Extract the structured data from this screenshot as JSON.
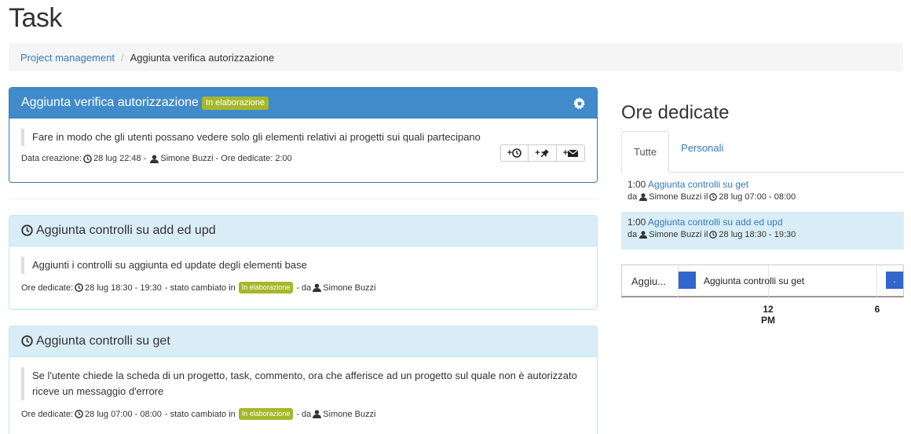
{
  "page": {
    "title": "Task"
  },
  "breadcrumb": {
    "link": "Project management",
    "current": "Aggiunta verifica autorizzazione"
  },
  "task": {
    "title": "Aggiunta verifica autorizzazione",
    "status": "In elaborazione",
    "description": "Fare in modo che gli utenti possano vedere solo gli elementi relativi ai progetti sui quali partecipano",
    "created_label": "Data creazione:",
    "created_date": "28 lug 22:48",
    "author": "Simone Buzzi",
    "hours_label": "- Ore dedicate: 2:00",
    "buttons": {
      "add_time": "+",
      "add_pin": "+",
      "add_mail": "+"
    }
  },
  "activities": [
    {
      "title": "Aggiunta controlli su add ed upd",
      "description": "Aggiunti i controlli su aggiunta ed update degli elementi base",
      "hours_label": "Ore dedicate:",
      "time": "28 lug 18:30 - 19:30",
      "status_label": "- stato cambiato in",
      "status": "In elaborazione",
      "by": "- da",
      "author": "Simone Buzzi"
    },
    {
      "title": "Aggiunta controlli su get",
      "description": "Se l'utente chiede la scheda di un progetto, task, commento, ora che afferisce ad un progetto sul quale non è autorizzato riceve un messaggio d'errore",
      "hours_label": "Ore dedicate:",
      "time": "28 lug 07:00 - 08:00",
      "status_label": "- stato cambiato in",
      "status": "In elaborazione",
      "by": "- da",
      "author": "Simone Buzzi"
    }
  ],
  "sidebar": {
    "title": "Ore dedicate",
    "tabs": [
      "Tutte",
      "Personali"
    ],
    "entries": [
      {
        "hours": "1:00",
        "title": "Aggiunta controlli su get",
        "by": "da",
        "author": "Simone Buzzi",
        "at": "il",
        "time": "28 lug 07:00 - 08:00"
      },
      {
        "hours": "1:00",
        "title": "Aggiunta controlli su add ed upd",
        "by": "da",
        "author": "Simone Buzzi",
        "at": "il",
        "time": "28 lug 18:30 - 19:30"
      }
    ],
    "timeline": {
      "row_label": "Aggiu...",
      "bar_label": "Aggiunta controlli su get",
      "end_label": ".",
      "ticks": [
        "12",
        "PM",
        "6"
      ],
      "bar_color": "#3366cc"
    }
  },
  "colors": {
    "primary": "#428bca",
    "status": "#a5b82b",
    "link": "#337ab7",
    "info_bg": "#d9edf7"
  }
}
